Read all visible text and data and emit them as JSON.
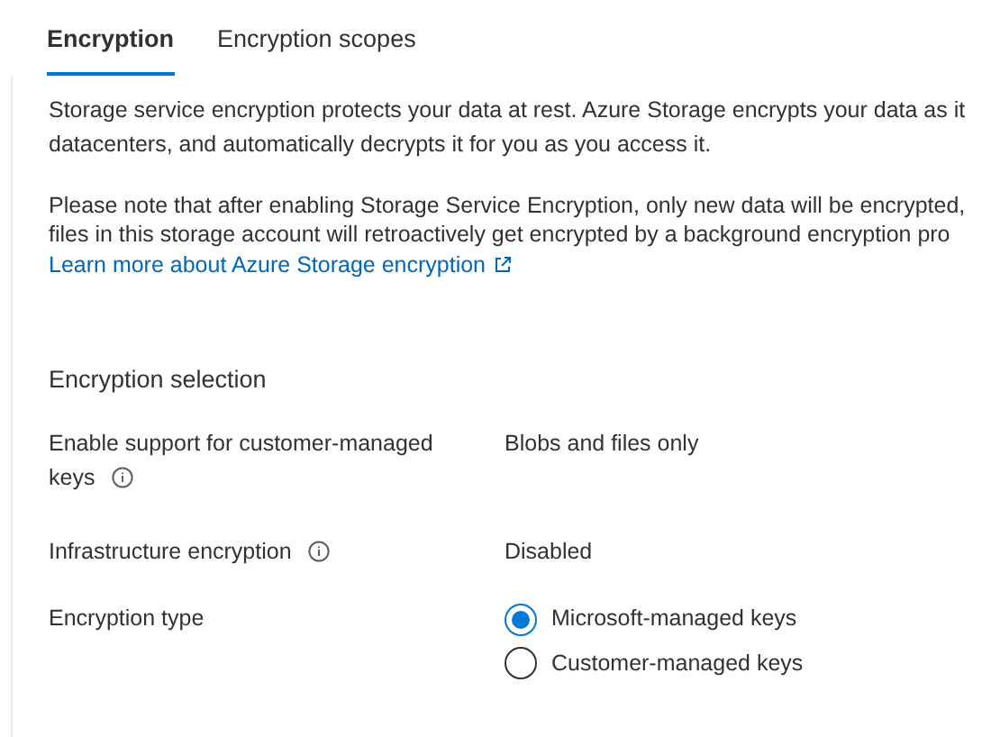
{
  "tabs": [
    {
      "label": "Encryption",
      "selected": true
    },
    {
      "label": "Encryption scopes",
      "selected": false
    }
  ],
  "intro": [
    "Storage service encryption protects your data at rest. Azure Storage encrypts your data as it",
    "datacenters, and automatically decrypts it for you as you access it."
  ],
  "note": [
    "Please note that after enabling Storage Service Encryption, only new data will be encrypted,",
    "files in this storage account will retroactively get encrypted by a background encryption pro"
  ],
  "learn_more_link": "Learn more about Azure Storage encryption",
  "section_title": "Encryption selection",
  "fields": [
    {
      "kind": "text",
      "label": "Enable support for customer-managed keys",
      "info": true,
      "value": "Blobs and files only"
    },
    {
      "kind": "text",
      "label": "Infrastructure encryption",
      "info": true,
      "value": "Disabled"
    },
    {
      "kind": "radio",
      "label": "Encryption type",
      "info": false,
      "options": [
        {
          "label": "Microsoft-managed keys",
          "selected": true
        },
        {
          "label": "Customer-managed keys",
          "selected": false
        }
      ]
    }
  ]
}
